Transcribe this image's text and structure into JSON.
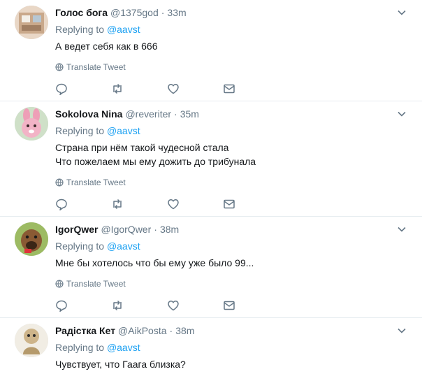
{
  "tweets": [
    {
      "name": "Голос бога",
      "handle": "@1375god",
      "separator": "·",
      "time": "33m",
      "replying_prefix": "Replying to",
      "replying_to": "@aavst",
      "lines": [
        "А ведет себя как в 666"
      ],
      "translate": "Translate Tweet",
      "avatar_color": "#d9b8a0"
    },
    {
      "name": "Sokolova Nina",
      "handle": "@reveriter",
      "separator": "·",
      "time": "35m",
      "replying_prefix": "Replying to",
      "replying_to": "@aavst",
      "lines": [
        "Страна при нём такой чудесной стала",
        "Что пожелаем мы ему дожить до трибунала"
      ],
      "translate": "Translate Tweet",
      "avatar_color": "#e8a0b4"
    },
    {
      "name": "IgorQwer",
      "handle": "@IgorQwer",
      "separator": "·",
      "time": "38m",
      "replying_prefix": "Replying to",
      "replying_to": "@aavst",
      "lines": [
        "Мне бы хотелось что бы ему уже было 99..."
      ],
      "translate": "Translate Tweet",
      "avatar_color": "#8fae5a"
    },
    {
      "name": "Радістка Кет",
      "handle": "@AikPosta",
      "separator": "·",
      "time": "38m",
      "replying_prefix": "Replying to",
      "replying_to": "@aavst",
      "lines": [
        "Чувствует, что Гаага близка?"
      ],
      "translate": "",
      "avatar_color": "#d8c9a0"
    }
  ],
  "colors": {
    "link": "#1da1f2",
    "muted": "#657786",
    "text": "#14171a",
    "divider": "#e6ecf0"
  },
  "icons": [
    "reply-icon",
    "retweet-icon",
    "like-icon",
    "dm-icon",
    "globe-icon",
    "chevron-down-icon"
  ]
}
